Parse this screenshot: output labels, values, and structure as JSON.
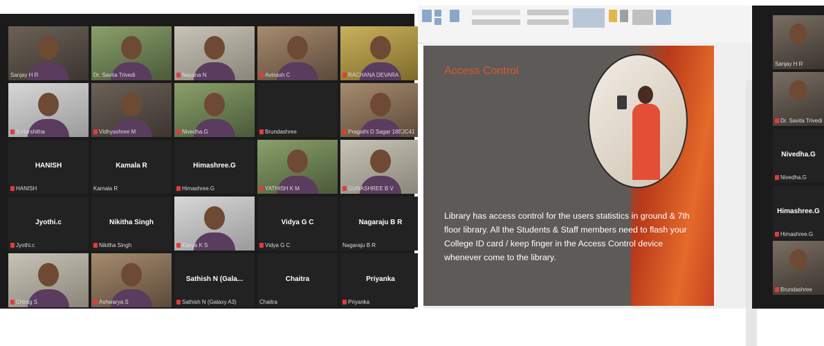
{
  "gallery": {
    "tiles": [
      {
        "label": "Sanjay H R",
        "big": "",
        "muted": false,
        "video": true
      },
      {
        "label": "Dr. Savita Trivedi",
        "big": "",
        "muted": false,
        "video": true,
        "active": true
      },
      {
        "label": "Nayana N",
        "big": "",
        "muted": true,
        "video": true
      },
      {
        "label": "Avinash C",
        "big": "",
        "muted": true,
        "video": true
      },
      {
        "label": "RACHANA DEVARA",
        "big": "",
        "muted": true,
        "video": true
      },
      {
        "label": "S Harshitha",
        "big": "",
        "muted": true,
        "video": true
      },
      {
        "label": "Vidhyashree M",
        "big": "",
        "muted": true,
        "video": true
      },
      {
        "label": "Nivedha.G",
        "big": "",
        "muted": true,
        "video": true
      },
      {
        "label": "Brundashree",
        "big": "",
        "muted": true,
        "video": false
      },
      {
        "label": "Pragathi D Sagar 18EJC41",
        "big": "",
        "muted": true,
        "video": true
      },
      {
        "label": "HANISH",
        "big": "HANISH",
        "muted": true,
        "video": false
      },
      {
        "label": "Kamala R",
        "big": "Kamala R",
        "muted": false,
        "video": false
      },
      {
        "label": "Himashree.G",
        "big": "Himashree.G",
        "muted": true,
        "video": false
      },
      {
        "label": "YATHISH K M",
        "big": "",
        "muted": true,
        "video": true
      },
      {
        "label": "GUNASHREE B V",
        "big": "",
        "muted": true,
        "video": true
      },
      {
        "label": "Jyothi.c",
        "big": "Jyothi.c",
        "muted": true,
        "video": false
      },
      {
        "label": "Nikitha Singh",
        "big": "Nikitha Singh",
        "muted": true,
        "video": false
      },
      {
        "label": "Kavya K S",
        "big": "",
        "muted": true,
        "video": true
      },
      {
        "label": "Vidya G C",
        "big": "Vidya G C",
        "muted": true,
        "video": false
      },
      {
        "label": "Nagaraju B R",
        "big": "Nagaraju B R",
        "muted": false,
        "video": false
      },
      {
        "label": "Chirag S",
        "big": "",
        "muted": true,
        "video": true
      },
      {
        "label": "Ashwarya.S",
        "big": "",
        "muted": true,
        "video": true
      },
      {
        "label": "Sathish N (Galaxy A3)",
        "big": "Sathish N (Gala...",
        "muted": true,
        "video": false
      },
      {
        "label": "Chaitra",
        "big": "Chaitra",
        "muted": false,
        "video": false
      },
      {
        "label": "Priyanka",
        "big": "Priyanka",
        "muted": true,
        "video": false
      }
    ]
  },
  "slide": {
    "title": "Access Control",
    "body": "Library has  access control for the users statistics in ground &  7th floor library. All the Students & Staff members  need to flash your College ID card / keep finger  in the Access Control device whenever come to the library."
  },
  "strip": {
    "tiles": [
      {
        "label": "Sanjay H R",
        "big": "",
        "muted": false,
        "video": true,
        "active": true
      },
      {
        "label": "Dr. Savita Trivedi",
        "big": "",
        "muted": true,
        "video": true
      },
      {
        "label": "Nivedha.G",
        "big": "Nivedha.G",
        "muted": true,
        "video": false
      },
      {
        "label": "Himashree.G",
        "big": "Himashree.G",
        "muted": true,
        "video": false
      },
      {
        "label": "Brundashree",
        "big": "",
        "muted": true,
        "video": true
      }
    ]
  },
  "colors": {
    "active_border": "#cde37a",
    "title": "#d55a2e",
    "slide_bg": "#5e5a57",
    "mute": "#e23b3b"
  }
}
